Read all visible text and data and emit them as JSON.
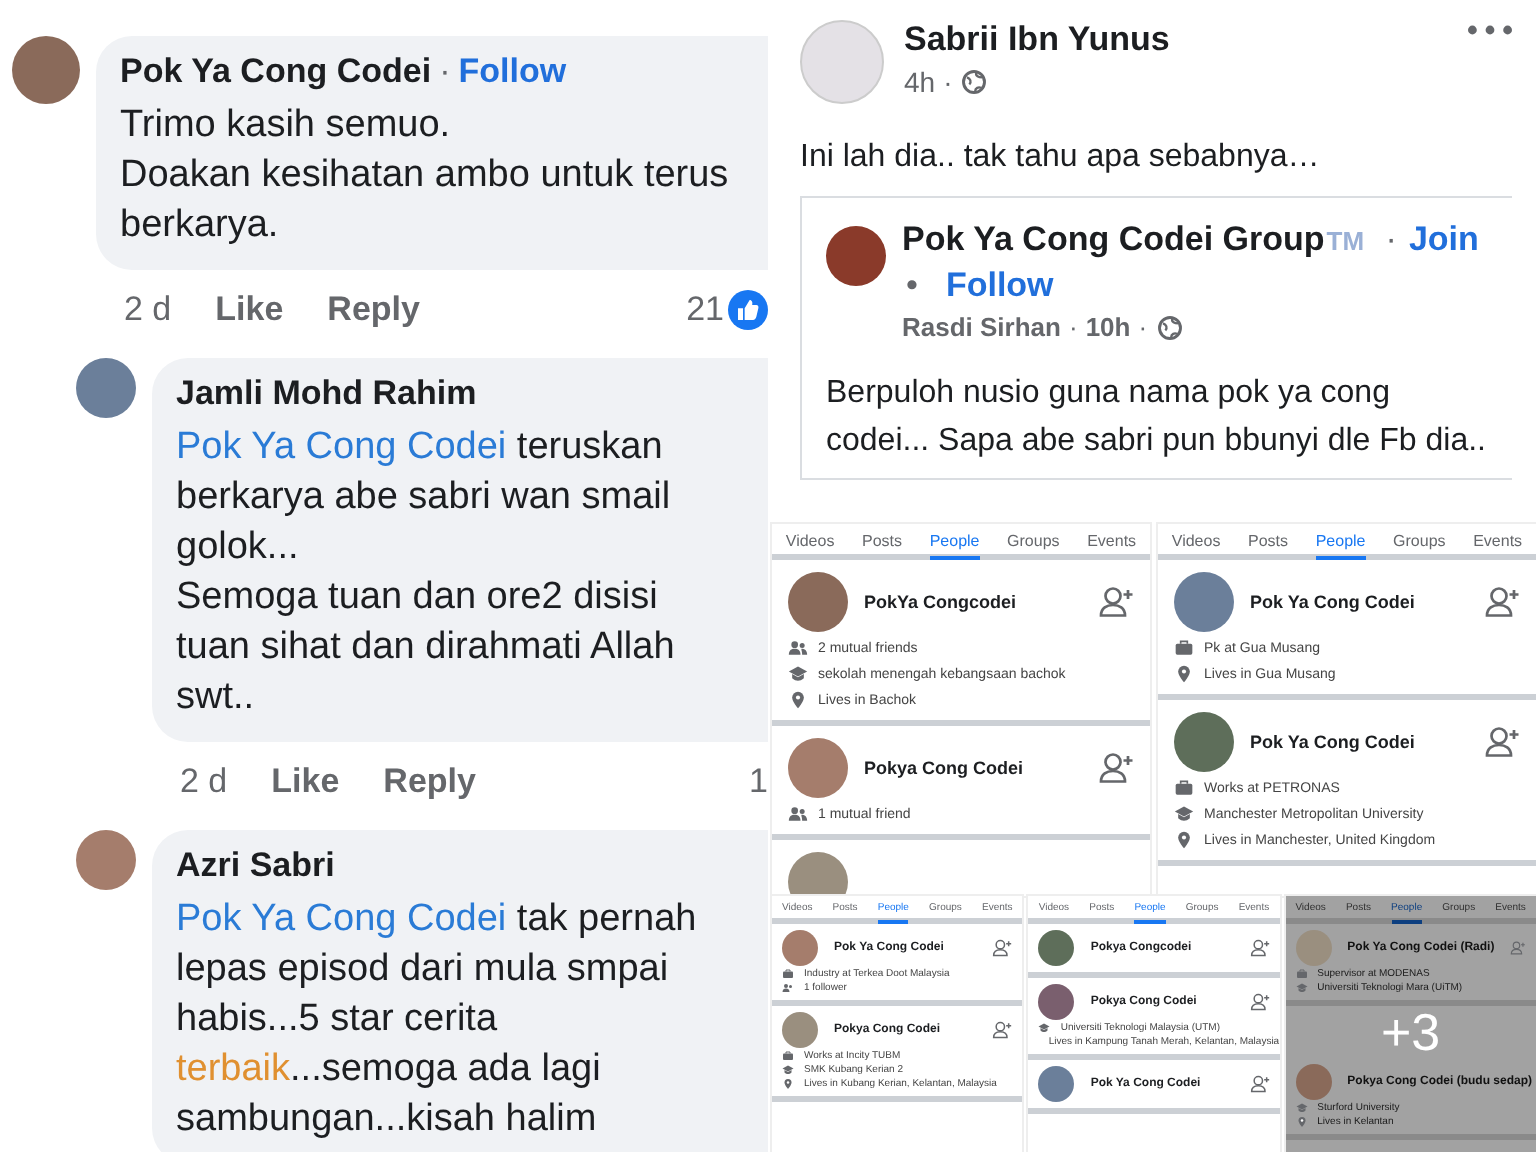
{
  "comments": [
    {
      "author": "Pok Ya Cong Codei",
      "separator": "·",
      "follow": "Follow",
      "lines": [
        [
          "Trimo kasih semuo."
        ],
        [
          "Doakan kesihatan ambo untuk terus"
        ],
        [
          "berkarya."
        ]
      ],
      "time": "2 d",
      "actions": [
        "Like",
        "Reply"
      ],
      "reactions": "21",
      "children": [
        {
          "author": "Jamli Mohd Rahim",
          "lines": [
            [
              {
                "kind": "mention",
                "text": "Pok Ya Cong Codei"
              },
              " teruskan"
            ],
            [
              "berkarya abe sabri wan smail"
            ],
            [
              "golok..."
            ],
            [
              "Semoga tuan dan ore2 disisi"
            ],
            [
              "tuan sihat dan dirahmati Allah"
            ],
            [
              "swt.."
            ]
          ],
          "time": "2 d",
          "actions": [
            "Like",
            "Reply"
          ],
          "reactions": "1"
        },
        {
          "author": "Azri Sabri",
          "lines": [
            [
              {
                "kind": "mention",
                "text": "Pok Ya Cong Codei"
              },
              " tak pernah"
            ],
            [
              "lepas episod dari mula smpai"
            ],
            [
              "habis...5 star cerita"
            ],
            [
              {
                "kind": "highlight",
                "text": "terbaik"
              },
              "...semoga ada lagi"
            ],
            [
              "sambungan...kisah halim"
            ]
          ]
        }
      ]
    }
  ],
  "post": {
    "author": "Sabrii Ibn Yunus",
    "time": "4h",
    "separator": "·",
    "text": "Ini lah dia.. tak tahu apa sebabnya…",
    "shared": {
      "group": "Pok Ya Cong Codei Group",
      "badge": "TM",
      "separator": "·",
      "join": "Join",
      "bullet": "•",
      "follow": "Follow",
      "author": "Rasdi Sirhan",
      "time": "10h",
      "text": "Berpuloh nusio guna nama pok ya cong codei... Sapa abe sabri pun bbunyi dle Fb dia.."
    }
  },
  "search_panels": [
    {
      "tabs": [
        {
          "label": "Videos",
          "selected": false
        },
        {
          "label": "Posts",
          "selected": false
        },
        {
          "label": "People",
          "selected": true
        },
        {
          "label": "Groups",
          "selected": false
        },
        {
          "label": "Events",
          "selected": false
        }
      ],
      "results": [
        {
          "name": "PokYa Congcodei",
          "details": [
            {
              "kind": "friends",
              "text": "2 mutual friends"
            },
            {
              "kind": "school",
              "text": "sekolah menengah kebangsaan bachok"
            },
            {
              "kind": "location",
              "text": "Lives in Bachok"
            }
          ]
        },
        {
          "name": "Pokya Cong Codei",
          "details": [
            {
              "kind": "friends",
              "text": "1 mutual friend"
            }
          ]
        },
        {
          "kind": "avatar_only"
        }
      ]
    },
    {
      "tabs": [
        {
          "label": "Videos",
          "selected": false
        },
        {
          "label": "Posts",
          "selected": false
        },
        {
          "label": "People",
          "selected": true
        },
        {
          "label": "Groups",
          "selected": false
        },
        {
          "label": "Events",
          "selected": false
        }
      ],
      "results": [
        {
          "name": "Pok Ya Cong Codei",
          "details": [
            {
              "kind": "work",
              "text": "Pk at Gua Musang"
            },
            {
              "kind": "location",
              "text": "Lives in Gua Musang"
            }
          ]
        },
        {
          "name": "Pok Ya Cong Codei",
          "details": [
            {
              "kind": "work",
              "text": "Works at PETRONAS"
            },
            {
              "kind": "school",
              "text": "Manchester Metropolitan University"
            },
            {
              "kind": "location",
              "text": "Lives in Manchester, United Kingdom"
            }
          ]
        }
      ]
    },
    {
      "tabs": [
        {
          "label": "Videos",
          "selected": false
        },
        {
          "label": "Posts",
          "selected": false
        },
        {
          "label": "People",
          "selected": true
        },
        {
          "label": "Groups",
          "selected": false
        },
        {
          "label": "Events",
          "selected": false
        }
      ],
      "results": [
        {
          "name": "Pok Ya Cong Codei",
          "details": [
            {
              "kind": "work",
              "text": "Industry at Terkea Doot Malaysia"
            },
            {
              "kind": "followers",
              "text": "1 follower"
            }
          ]
        },
        {
          "name": "Pokya Cong Codei",
          "details": [
            {
              "kind": "work",
              "text": "Works at Incity TUBM"
            },
            {
              "kind": "school",
              "text": "SMK Kubang Kerian 2"
            },
            {
              "kind": "location",
              "text": "Lives in Kubang Kerian, Kelantan, Malaysia"
            }
          ]
        }
      ]
    },
    {
      "tabs": [
        {
          "label": "Videos",
          "selected": false
        },
        {
          "label": "Posts",
          "selected": false
        },
        {
          "label": "People",
          "selected": true
        },
        {
          "label": "Groups",
          "selected": false
        },
        {
          "label": "Events",
          "selected": false
        }
      ],
      "results": [
        {
          "name": "Pokya Congcodei"
        },
        {
          "name": "Pokya Cong Codei",
          "details": [
            {
              "kind": "school",
              "text": "Universiti Teknologi Malaysia (UTM)"
            },
            {
              "kind": "location",
              "text": "Lives in Kampung Tanah Merah, Kelantan, Malaysia"
            }
          ]
        },
        {
          "name": "Pok Ya Cong Codei"
        }
      ]
    },
    {
      "overlay": "+3",
      "tabs": [
        {
          "label": "Videos",
          "selected": false
        },
        {
          "label": "Posts",
          "selected": false
        },
        {
          "label": "People",
          "selected": true
        },
        {
          "label": "Groups",
          "selected": false
        },
        {
          "label": "Events",
          "selected": false
        }
      ],
      "results": [
        {
          "name": "Pok Ya Cong Codei (Radi)",
          "details": [
            {
              "kind": "work",
              "text": "Supervisor at MODENAS"
            },
            {
              "kind": "school",
              "text": "Universiti Teknologi Mara (UiTM)"
            }
          ]
        },
        {
          "name": "Pokya Cong Codei (budu sedap)",
          "details": [
            {
              "kind": "school",
              "text": "Sturford University"
            },
            {
              "kind": "location",
              "text": "Lives in Kelantan"
            }
          ]
        }
      ]
    }
  ]
}
